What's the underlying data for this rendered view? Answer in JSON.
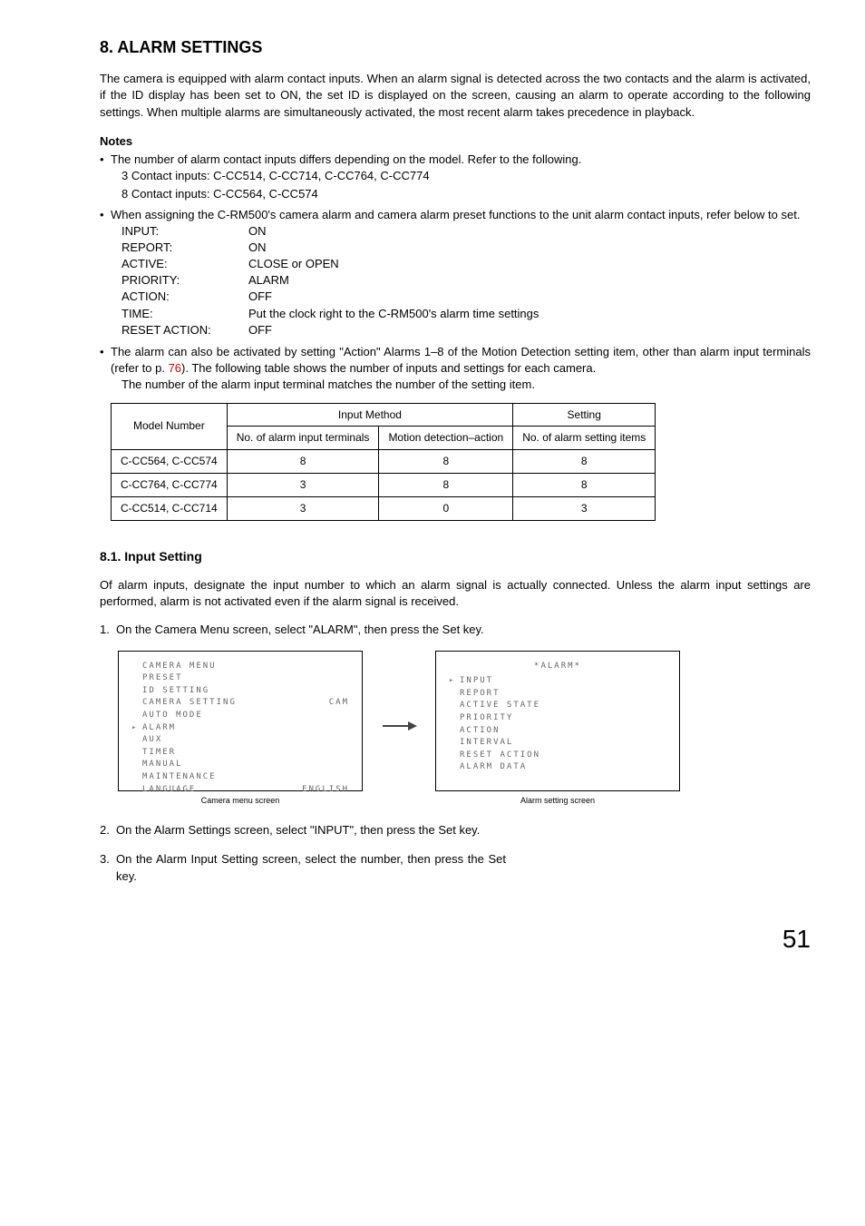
{
  "h1": "8. ALARM SETTINGS",
  "intro": "The camera is equipped with alarm contact inputs. When an alarm signal is detected across the two contacts and the alarm is activated, if the ID display has been set to ON, the set ID is displayed on the screen, causing an alarm to operate according to the following settings. When multiple alarms are simultaneously activated, the most recent alarm takes precedence in playback.",
  "notes_heading": "Notes",
  "note1": "The number of alarm contact inputs differs depending on the model. Refer to the following.",
  "note1_sub1": "3 Contact inputs: C-CC514, C-CC714, C-CC764, C-CC774",
  "note1_sub2": "8 Contact inputs: C-CC564, C-CC574",
  "note2": "When assigning the C-RM500's camera alarm and camera alarm preset functions to the unit alarm contact inputs, refer below to set.",
  "kv": [
    {
      "k": "INPUT:",
      "v": "ON"
    },
    {
      "k": "REPORT:",
      "v": "ON"
    },
    {
      "k": "ACTIVE:",
      "v": "CLOSE or OPEN"
    },
    {
      "k": "PRIORITY:",
      "v": "ALARM"
    },
    {
      "k": "ACTION:",
      "v": "OFF"
    },
    {
      "k": "TIME:",
      "v": "Put the clock right to the C-RM500's alarm time settings"
    },
    {
      "k": "RESET ACTION:",
      "v": "OFF"
    }
  ],
  "note3_a": "The alarm can also be activated by setting \"Action\" Alarms 1–8 of the Motion Detection setting item, other than alarm input terminals (refer to p. ",
  "note3_page": "76",
  "note3_b": "). The following table shows the number of inputs and settings for each camera.",
  "note3_sub": "The number of the alarm input terminal matches the number of the setting item.",
  "table": {
    "head_model": "Model Number",
    "head_input_method": "Input Method",
    "head_setting": "Setting",
    "head_col1": "No. of alarm input terminals",
    "head_col2": "Motion detection–action",
    "head_col3": "No. of alarm setting items",
    "rows": [
      {
        "model": "C-CC564, C-CC574",
        "c1": "8",
        "c2": "8",
        "c3": "8"
      },
      {
        "model": "C-CC764, C-CC774",
        "c1": "3",
        "c2": "8",
        "c3": "8"
      },
      {
        "model": "C-CC514, C-CC714",
        "c1": "3",
        "c2": "0",
        "c3": "3"
      }
    ]
  },
  "h2": "8.1. Input Setting",
  "h2_intro": "Of alarm inputs, designate the input number to which an alarm signal is actually connected. Unless the alarm input settings are performed, alarm is not activated even if the alarm signal is received.",
  "step1": "On the Camera Menu screen, select \"ALARM\", then press the Set key.",
  "step2": "On the Alarm Settings screen, select \"INPUT\", then press the Set key.",
  "step3": "On the Alarm Input Setting screen, select the number, then press the Set key.",
  "screen_left": {
    "title": "CAMERA MENU",
    "lines": [
      {
        "label": "PRESET",
        "right": ""
      },
      {
        "label": "ID SETTING",
        "right": ""
      },
      {
        "label": "CAMERA SETTING",
        "right": "CAM"
      },
      {
        "label": "AUTO MODE",
        "right": ""
      },
      {
        "label": "ALARM",
        "right": "",
        "arrow": true
      },
      {
        "label": "AUX",
        "right": ""
      },
      {
        "label": "TIMER",
        "right": ""
      },
      {
        "label": "MANUAL",
        "right": ""
      },
      {
        "label": "MAINTENANCE",
        "right": ""
      },
      {
        "label": "LANGUAGE",
        "right": "ENGLISH"
      }
    ],
    "caption": "Camera menu screen"
  },
  "screen_right": {
    "title": "*ALARM*",
    "lines": [
      {
        "label": "INPUT",
        "arrow": true
      },
      {
        "label": "REPORT"
      },
      {
        "label": "ACTIVE STATE"
      },
      {
        "label": "PRIORITY"
      },
      {
        "label": "ACTION"
      },
      {
        "label": "INTERVAL"
      },
      {
        "label": "RESET ACTION"
      },
      {
        "label": "ALARM DATA"
      }
    ],
    "caption": "Alarm setting screen"
  },
  "page_number": "51"
}
